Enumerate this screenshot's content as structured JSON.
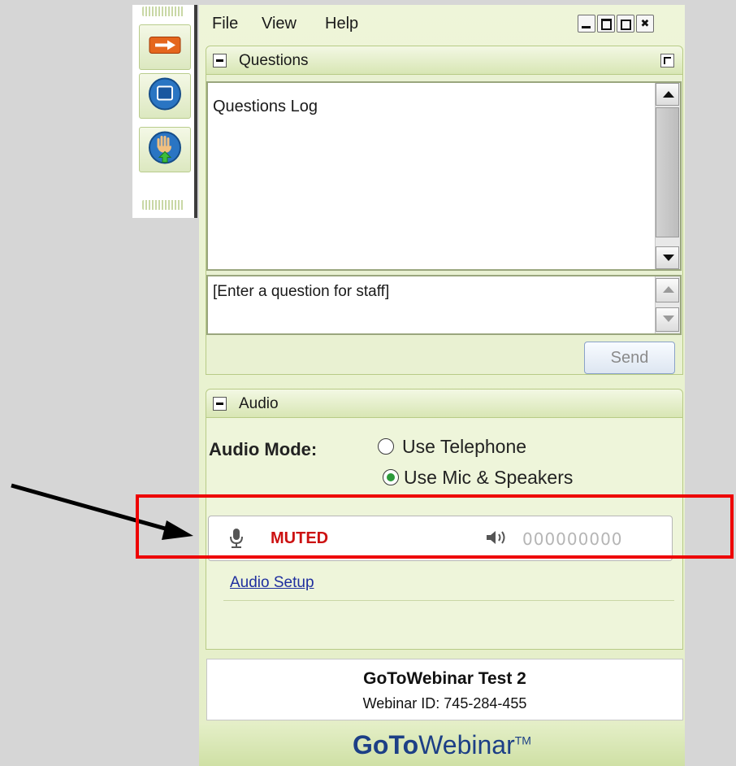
{
  "menu": {
    "file": "File",
    "view": "View",
    "help": "Help"
  },
  "window_buttons": {
    "minimize": "_",
    "maximize": "□",
    "popout": "⇗",
    "close": "✖"
  },
  "questions": {
    "title": "Questions",
    "log_label": "Questions Log",
    "input_placeholder": "[Enter a question for staff]",
    "send_label": "Send"
  },
  "audio": {
    "title": "Audio",
    "mode_label": "Audio Mode:",
    "options": [
      "Use Telephone",
      "Use Mic & Speakers"
    ],
    "selected_option": "Use Mic & Speakers",
    "mic_status": "MUTED",
    "speaker_level": "000000000",
    "setup_link": "Audio Setup"
  },
  "webinar": {
    "name": "GoToWebinar Test 2",
    "id_text": "Webinar ID: 745-284-455",
    "brand_bold": "GoTo",
    "brand_light": "Webinar",
    "brand_tm": "TM"
  },
  "colors": {
    "muted_red": "#cc1111",
    "highlight_red": "#ee0000",
    "radio_green": "#2c9a3a",
    "panel_green": "#e4eec7",
    "brand_blue": "#1c3f86"
  }
}
